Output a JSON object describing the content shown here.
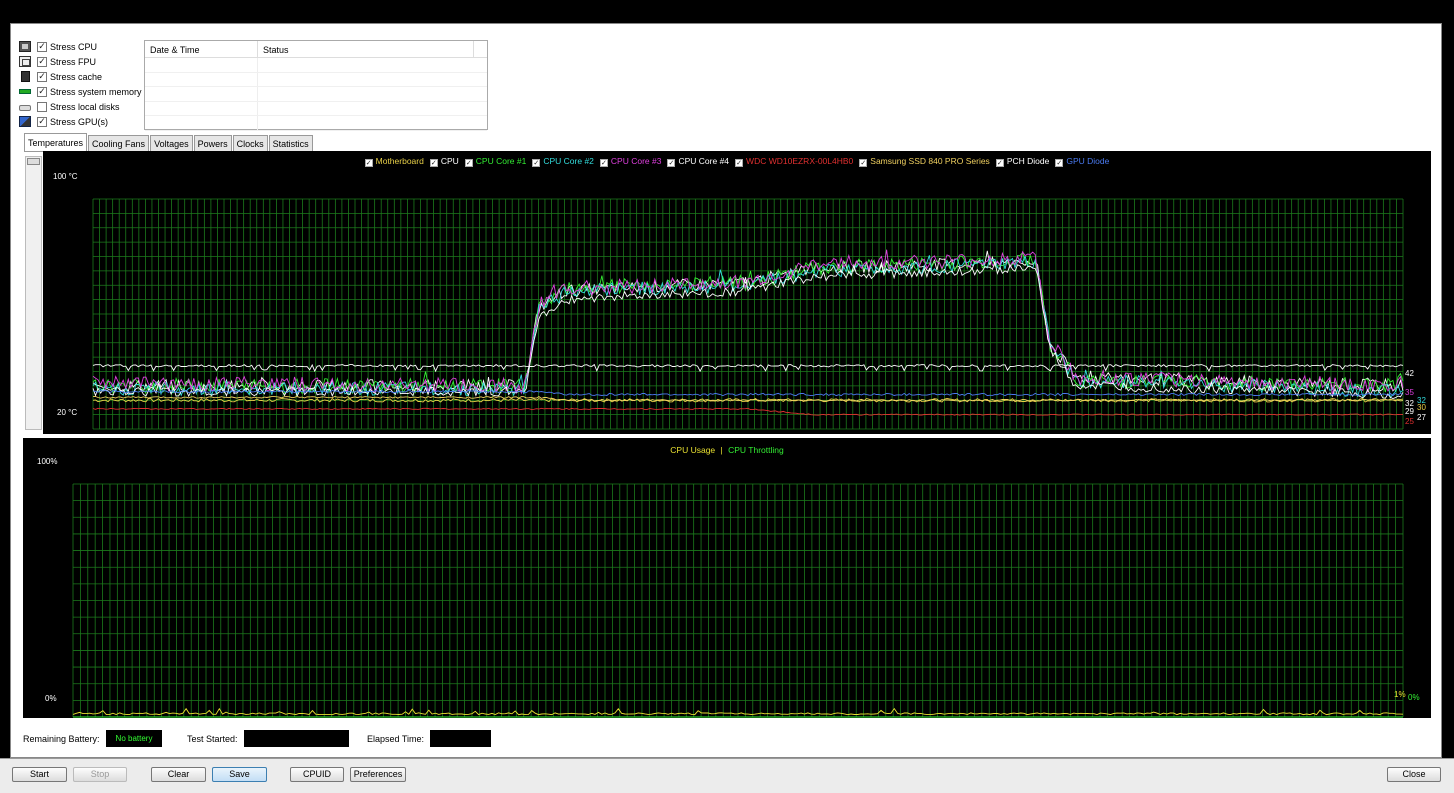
{
  "stress_options": [
    {
      "label": "Stress CPU",
      "checked": true,
      "icon": "cpu-icon"
    },
    {
      "label": "Stress FPU",
      "checked": true,
      "icon": "fpu-icon"
    },
    {
      "label": "Stress cache",
      "checked": true,
      "icon": "cache-icon"
    },
    {
      "label": "Stress system memory",
      "checked": true,
      "icon": "memory-icon"
    },
    {
      "label": "Stress local disks",
      "checked": false,
      "icon": "disk-icon"
    },
    {
      "label": "Stress GPU(s)",
      "checked": true,
      "icon": "gpu-icon"
    }
  ],
  "log": {
    "col_date": "Date & Time",
    "col_status": "Status",
    "rows": []
  },
  "tabs": [
    "Temperatures",
    "Cooling Fans",
    "Voltages",
    "Powers",
    "Clocks",
    "Statistics"
  ],
  "active_tab": "Temperatures",
  "temp_graph": {
    "legend": [
      {
        "label": "Motherboard",
        "color": "#e8d048",
        "checked": true
      },
      {
        "label": "CPU",
        "color": "#ffffff",
        "checked": true
      },
      {
        "label": "CPU Core #1",
        "color": "#33ee33",
        "checked": true
      },
      {
        "label": "CPU Core #2",
        "color": "#33dddd",
        "checked": true
      },
      {
        "label": "CPU Core #3",
        "color": "#e040e0",
        "checked": true
      },
      {
        "label": "CPU Core #4",
        "color": "#ffffff",
        "checked": true
      },
      {
        "label": "WDC WD10EZRX-00L4HB0",
        "color": "#e03030",
        "checked": true
      },
      {
        "label": "Samsung SSD 840 PRO Series",
        "color": "#f0d060",
        "checked": true
      },
      {
        "label": "PCH Diode",
        "color": "#ffffff",
        "checked": true
      },
      {
        "label": "GPU Diode",
        "color": "#4a7af0",
        "checked": true
      }
    ],
    "y_max_label": "100 °C",
    "y_min_label": "20 °C",
    "end_values": [
      {
        "text": "42",
        "color": "#ffffff"
      },
      {
        "text": "35",
        "color": "#e040e0"
      },
      {
        "text": "32",
        "color": "#33dddd"
      },
      {
        "text": "32",
        "color": "#ffffff"
      },
      {
        "text": "30",
        "color": "#e8d048"
      },
      {
        "text": "29",
        "color": "#ffffff"
      },
      {
        "text": "27",
        "color": "#ffffff"
      },
      {
        "text": "25",
        "color": "#e03030"
      }
    ]
  },
  "cpu_graph": {
    "legend_usage": "CPU Usage",
    "legend_sep": "|",
    "legend_throttling": "CPU Throttling",
    "usage_color": "#e8e030",
    "throttling_color": "#33ee33",
    "y_max_label": "100%",
    "y_min_label": "0%",
    "end_usage": "1%",
    "end_throttling": "0%"
  },
  "chart_data": [
    {
      "type": "line",
      "title": "",
      "ylim": [
        20,
        100
      ],
      "x": [
        0,
        0.33,
        0.34,
        0.36,
        0.5,
        0.55,
        0.72,
        0.73,
        0.75,
        1.0
      ],
      "series": [
        {
          "name": "Motherboard",
          "values": [
            30,
            30,
            30,
            30,
            30,
            30,
            30,
            30,
            30,
            30
          ]
        },
        {
          "name": "CPU",
          "values": [
            35,
            35,
            62,
            68,
            71,
            76,
            78,
            50,
            38,
            35
          ]
        },
        {
          "name": "CPU Core #1",
          "values": [
            35,
            35,
            62,
            69,
            71,
            76,
            79,
            50,
            37,
            35
          ]
        },
        {
          "name": "CPU Core #2",
          "values": [
            34,
            34,
            62,
            68,
            70,
            75,
            78,
            50,
            37,
            33
          ]
        },
        {
          "name": "CPU Core #3",
          "values": [
            36,
            35,
            63,
            69,
            71,
            77,
            79,
            51,
            38,
            35
          ]
        },
        {
          "name": "CPU Core #4",
          "values": [
            33,
            33,
            58,
            65,
            68,
            73,
            76,
            48,
            35,
            32
          ]
        },
        {
          "name": "WDC WD10EZRX-00L4HB0",
          "values": [
            27,
            27,
            27,
            27,
            27,
            25,
            25,
            25,
            25,
            25
          ]
        },
        {
          "name": "Samsung SSD 840 PRO Series",
          "values": [
            31,
            31,
            31,
            30,
            30,
            30,
            30,
            30,
            30,
            30
          ]
        },
        {
          "name": "PCH Diode",
          "values": [
            42,
            42,
            42,
            42,
            42,
            42,
            42,
            42,
            42,
            42
          ]
        },
        {
          "name": "GPU Diode",
          "values": [
            33,
            33,
            33,
            32,
            32,
            32,
            32,
            32,
            32,
            32
          ]
        }
      ]
    },
    {
      "type": "line",
      "title": "",
      "ylim": [
        0,
        100
      ],
      "x": [
        0,
        1
      ],
      "series": [
        {
          "name": "CPU Usage",
          "values": [
            1,
            1
          ]
        },
        {
          "name": "CPU Throttling",
          "values": [
            0,
            0
          ]
        }
      ]
    }
  ],
  "status": {
    "battery_label": "Remaining Battery:",
    "battery_value": "No battery",
    "test_started_label": "Test Started:",
    "test_started_value": "",
    "elapsed_label": "Elapsed Time:",
    "elapsed_value": ""
  },
  "buttons": {
    "start": "Start",
    "stop": "Stop",
    "clear": "Clear",
    "save": "Save",
    "cpuid": "CPUID",
    "preferences": "Preferences",
    "close": "Close"
  }
}
